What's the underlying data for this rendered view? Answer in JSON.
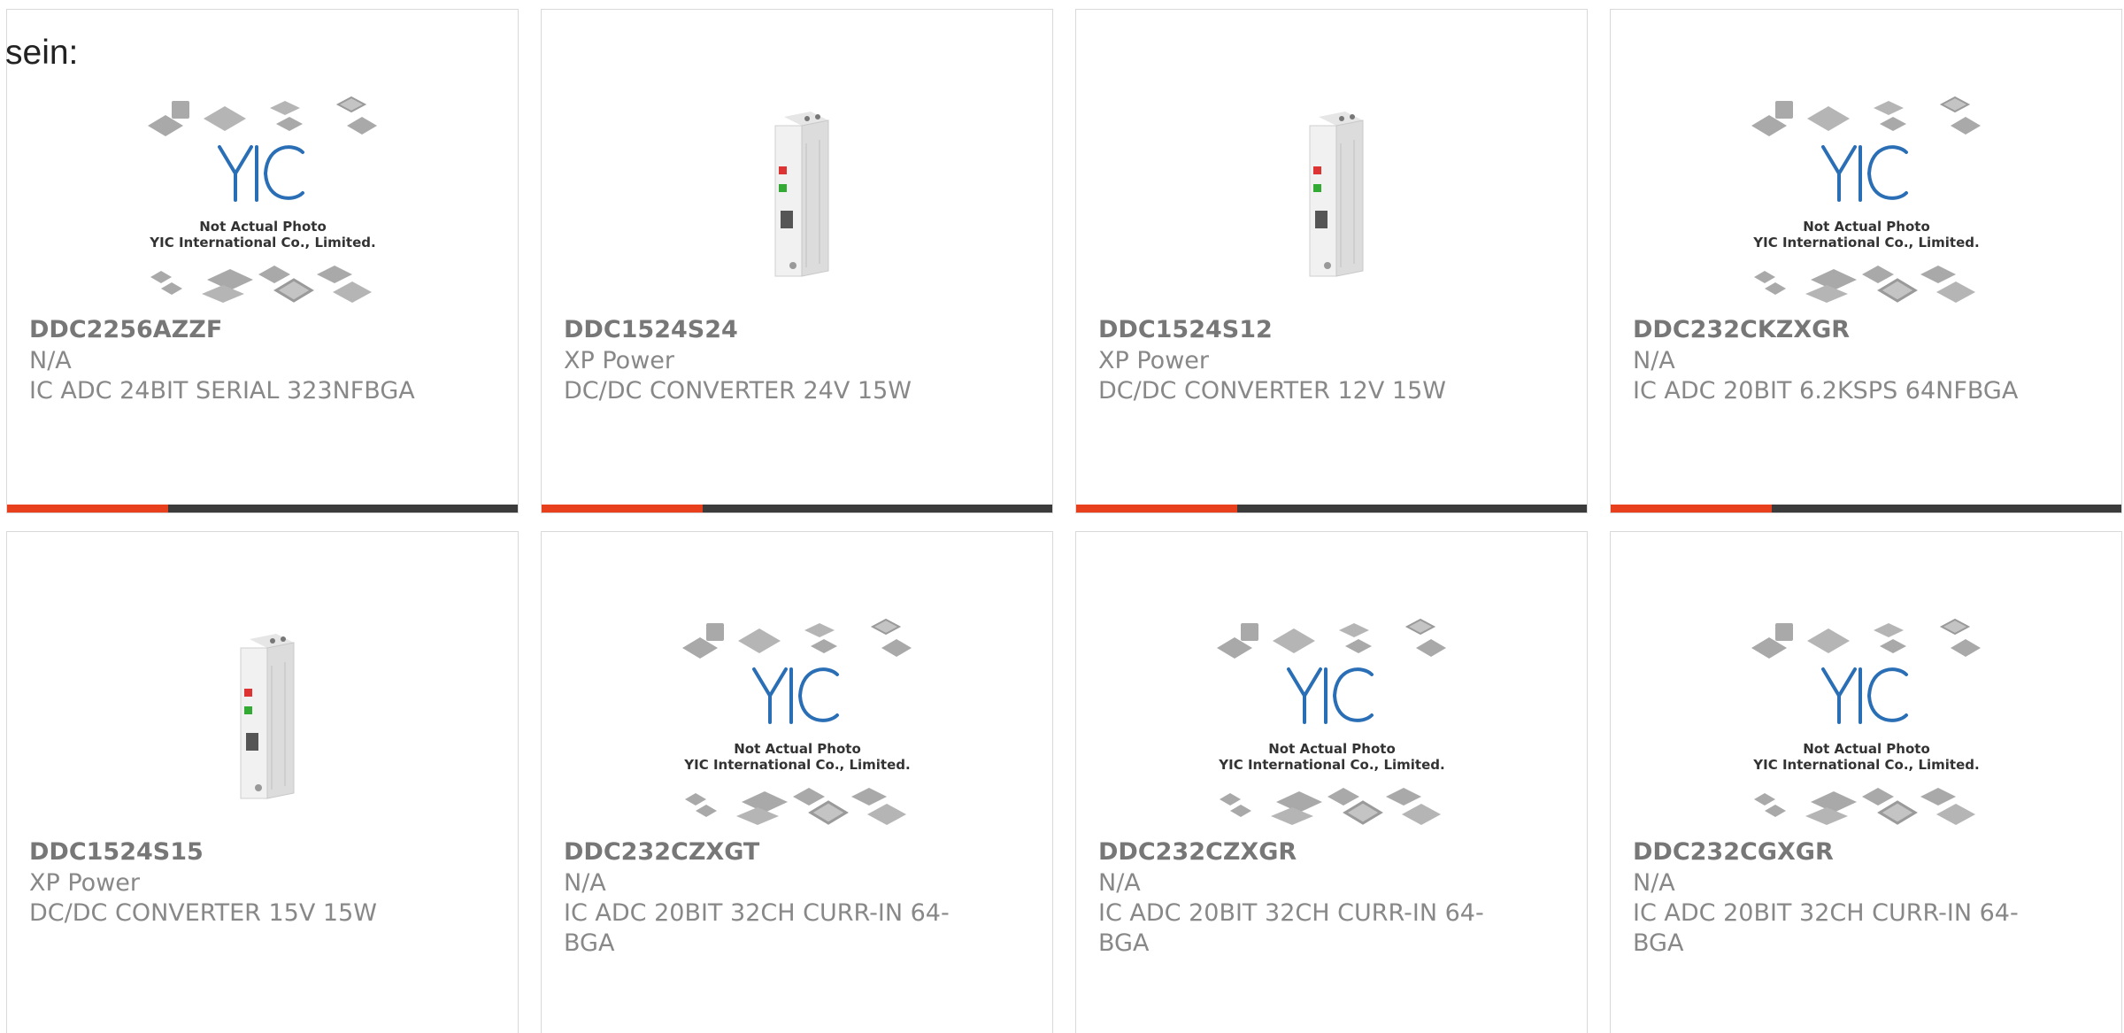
{
  "lead_text": "sein:",
  "colors": {
    "accent_bar": "#e8401c",
    "dark_bar": "#3b3b3b",
    "card_border": "#d9d9d9",
    "text": "#777777",
    "logo_blue": "#2a6fb5"
  },
  "placeholder": {
    "line1": "Not Actual Photo",
    "line2": "YIC International Co., Limited.",
    "logo_text": "YIC"
  },
  "products": [
    {
      "part": "DDC2256AZZF",
      "manufacturer": "N/A",
      "description": "IC ADC 24BIT SERIAL 323NFBGA",
      "image": "placeholder-chip-icon"
    },
    {
      "part": "DDC1524S24",
      "manufacturer": "XP Power",
      "description": "DC/DC CONVERTER 24V 15W",
      "image": "din-rail-module-icon"
    },
    {
      "part": "DDC1524S12",
      "manufacturer": "XP Power",
      "description": "DC/DC CONVERTER 12V 15W",
      "image": "din-rail-module-icon"
    },
    {
      "part": "DDC232CKZXGR",
      "manufacturer": "N/A",
      "description": "IC ADC 20BIT 6.2KSPS 64NFBGA",
      "image": "placeholder-chip-icon"
    },
    {
      "part": "DDC1524S15",
      "manufacturer": "XP Power",
      "description": "DC/DC CONVERTER 15V 15W",
      "image": "din-rail-module-icon"
    },
    {
      "part": "DDC232CZXGT",
      "manufacturer": "N/A",
      "description": "IC ADC 20BIT 32CH CURR-IN 64-BGA",
      "image": "placeholder-chip-icon"
    },
    {
      "part": "DDC232CZXGR",
      "manufacturer": "N/A",
      "description": "IC ADC 20BIT 32CH CURR-IN 64-BGA",
      "image": "placeholder-chip-icon"
    },
    {
      "part": "DDC232CGXGR",
      "manufacturer": "N/A",
      "description": "IC ADC 20BIT 32CH CURR-IN 64-BGA",
      "image": "placeholder-chip-icon"
    }
  ]
}
